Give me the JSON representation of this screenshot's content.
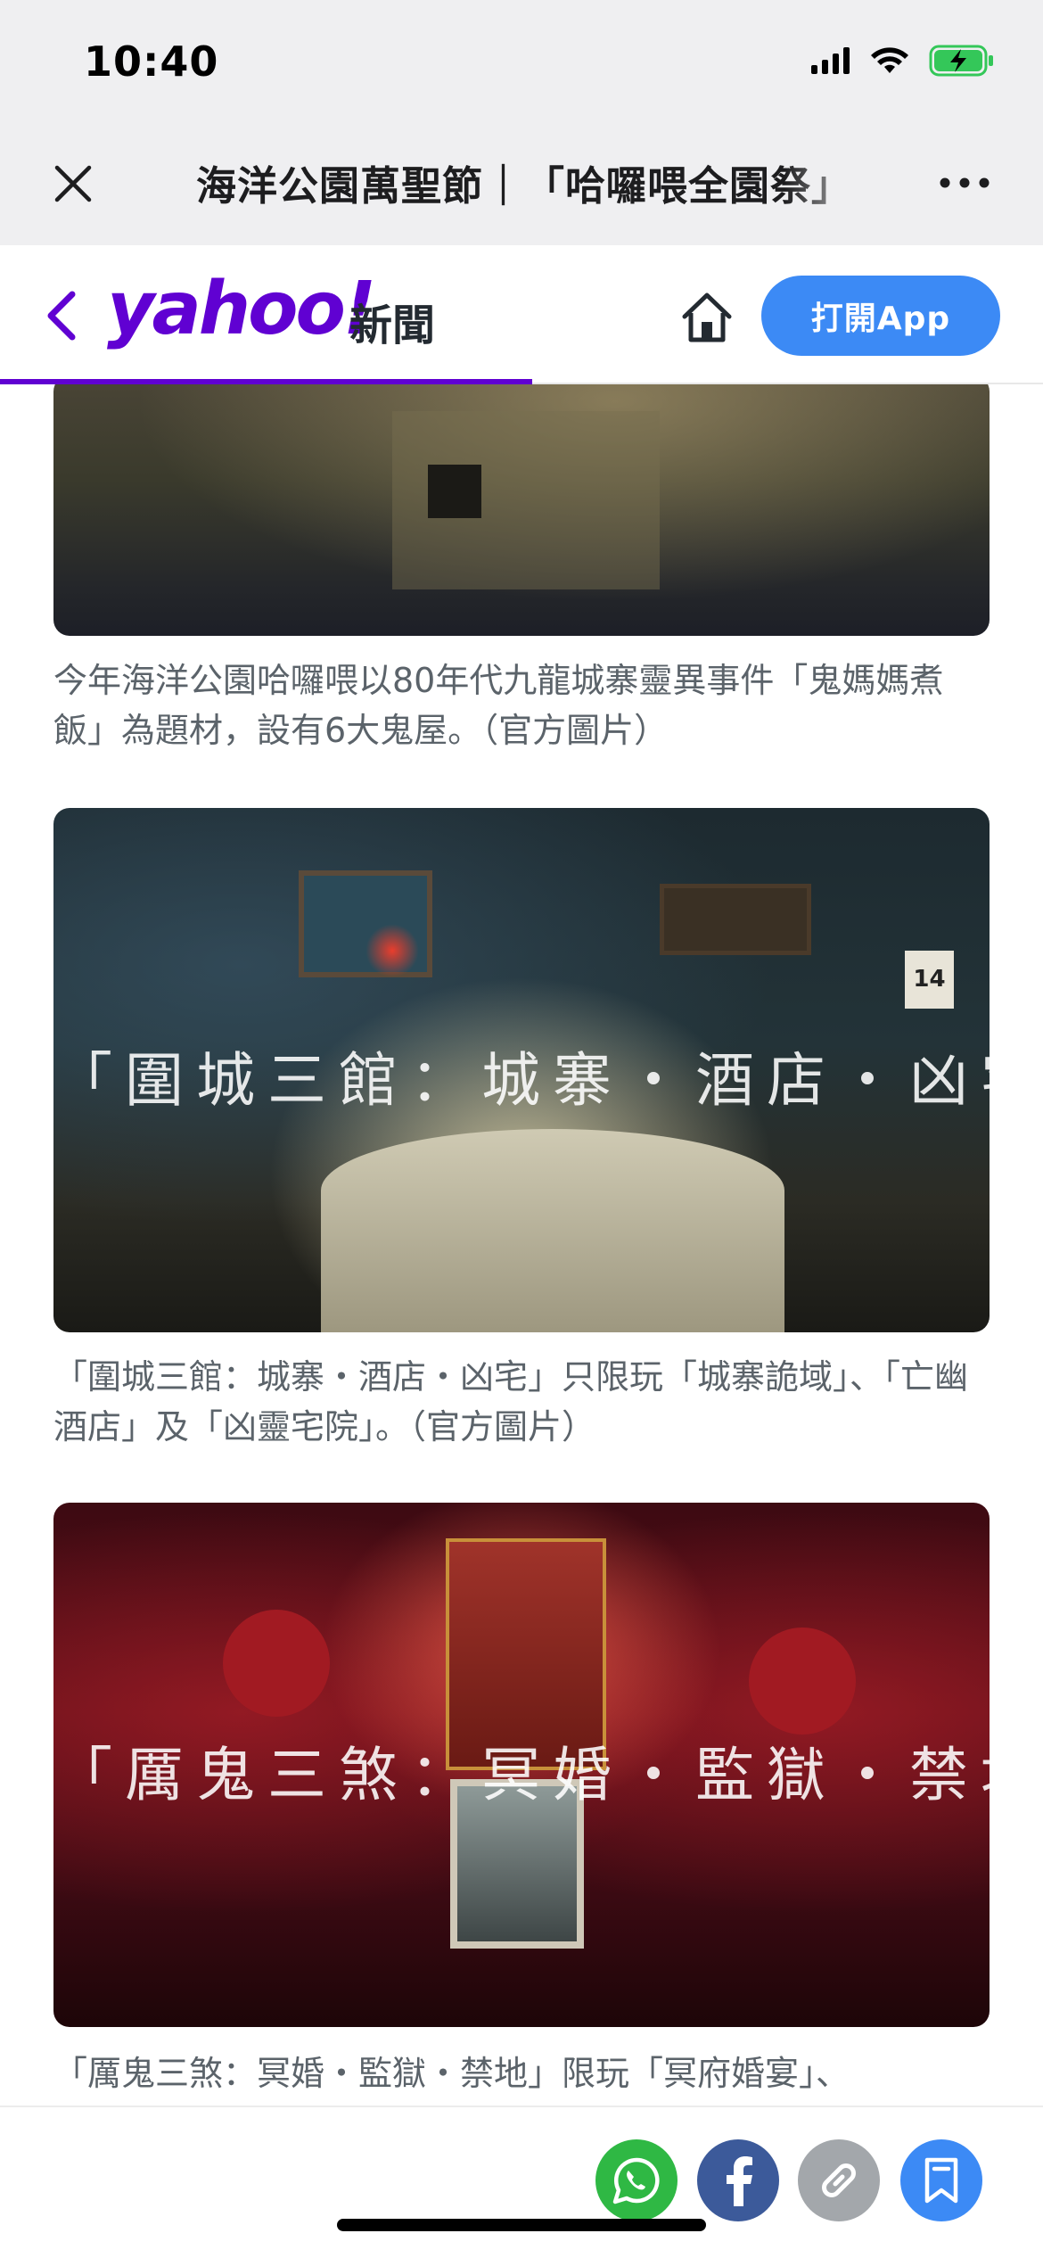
{
  "status_bar": {
    "time": "10:40",
    "icons": [
      "signal-icon",
      "wifi-icon",
      "battery-charging-icon"
    ],
    "battery_color": "#34c759"
  },
  "browser": {
    "title": "海洋公園萬聖節｜「哈囉喂全園祭」",
    "close_icon": "close-icon",
    "more_icon": "more-icon"
  },
  "header": {
    "logo": "yahoo!",
    "section": "新聞",
    "open_app_label": "打開App",
    "brand_color": "#6001d2",
    "button_color": "#3c8af5",
    "read_progress": 0.51
  },
  "article": {
    "figures": [
      {
        "caption": "今年海洋公園哈囉喂以80年代九龍城寨靈異事件「鬼媽媽煮飯」為題材，設有6大鬼屋。（官方圖片）"
      },
      {
        "overlay": "「圍城三館：城寨・酒店・凶宅」",
        "calendar": "14",
        "caption": "「圍城三館：城寨・酒店・凶宅」只限玩「城寨詭域」、「亡幽酒店」及「凶靈宅院」。（官方圖片）"
      },
      {
        "overlay": "「厲鬼三煞：冥婚・監獄・禁地」",
        "caption": "「厲鬼三煞：冥婚・監獄・禁地」限玩「冥府婚宴」、"
      }
    ]
  },
  "share_bar": {
    "buttons": [
      {
        "name": "whatsapp",
        "icon": "whatsapp-icon",
        "color": "#2fb844"
      },
      {
        "name": "facebook",
        "icon": "facebook-icon",
        "color": "#3c5a9a"
      },
      {
        "name": "copy-link",
        "icon": "link-icon",
        "color": "#a3a7ab"
      },
      {
        "name": "bookmark",
        "icon": "bookmark-icon",
        "color": "#3c8af5"
      }
    ]
  }
}
